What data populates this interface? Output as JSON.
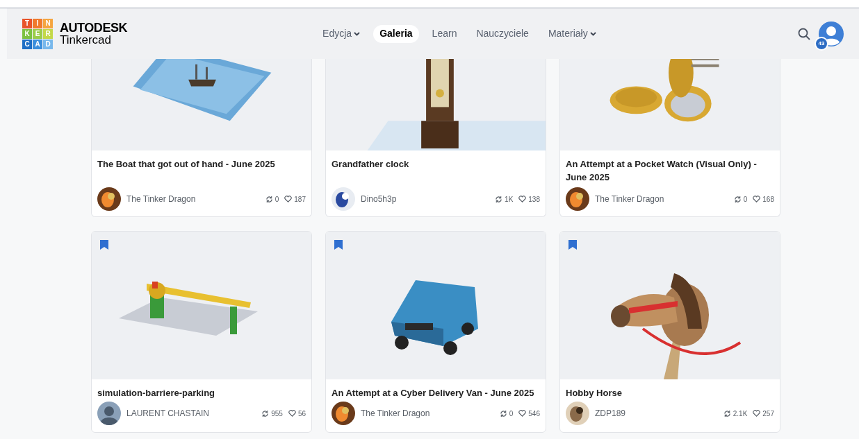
{
  "header": {
    "logo_tiles": [
      {
        "letter": "T",
        "color": "#e8542a"
      },
      {
        "letter": "I",
        "color": "#f07a2c"
      },
      {
        "letter": "N",
        "color": "#f5a540"
      },
      {
        "letter": "K",
        "color": "#7cc242"
      },
      {
        "letter": "E",
        "color": "#9ccc4a"
      },
      {
        "letter": "R",
        "color": "#c4d84a"
      },
      {
        "letter": "C",
        "color": "#1f6fc5"
      },
      {
        "letter": "A",
        "color": "#3c8fdc"
      },
      {
        "letter": "D",
        "color": "#78b8ec"
      }
    ],
    "brand": "AUTODESK",
    "product": "Tinkercad",
    "nav": [
      {
        "label": "Edycja",
        "dropdown": true,
        "selected": false
      },
      {
        "label": "Galeria",
        "dropdown": false,
        "selected": true
      },
      {
        "label": "Learn",
        "dropdown": false,
        "selected": false
      },
      {
        "label": "Nauczyciele",
        "dropdown": false,
        "selected": false
      },
      {
        "label": "Materiały",
        "dropdown": true,
        "selected": false
      }
    ],
    "notification_count": "43"
  },
  "cards": [
    {
      "title": "The Boat that got out of hand - June 2025",
      "author": "The Tinker Dragon",
      "remixes": "0",
      "likes": "187"
    },
    {
      "title": "Grandfather clock",
      "author": "Dino5h3p",
      "remixes": "1K",
      "likes": "138"
    },
    {
      "title": "An Attempt at a Pocket Watch (Visual Only) - June 2025",
      "author": "The Tinker Dragon",
      "remixes": "0",
      "likes": "168"
    },
    {
      "title": "simulation-barriere-parking",
      "author": "LAURENT CHASTAIN",
      "remixes": "955",
      "likes": "56",
      "bookmarked": true
    },
    {
      "title": "An Attempt at a Cyber Delivery Van - June 2025",
      "author": "The Tinker Dragon",
      "remixes": "0",
      "likes": "546",
      "bookmarked": true
    },
    {
      "title": "Hobby Horse",
      "author": "ZDP189",
      "remixes": "2.1K",
      "likes": "257",
      "bookmarked": true
    }
  ]
}
